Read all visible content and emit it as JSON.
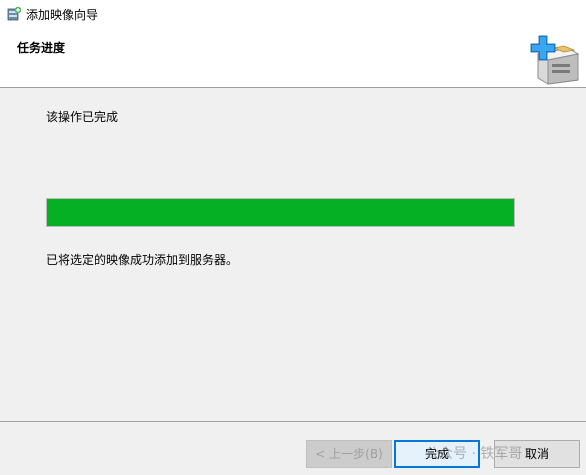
{
  "window": {
    "title": "添加映像向导"
  },
  "header": {
    "step_title": "任务进度"
  },
  "content": {
    "status_text": "该操作已完成",
    "progress_percent": 100,
    "result_text": "已将选定的映像成功添加到服务器。"
  },
  "buttons": {
    "back_label": "< 上一步(B)",
    "finish_label": "完成",
    "cancel_label": "取消"
  },
  "watermark": {
    "text": "公众号 · 铁军哥"
  },
  "colors": {
    "progress_fill": "#06b025",
    "default_button_border": "#0078d7",
    "icon_plus": "#1e90e0"
  }
}
